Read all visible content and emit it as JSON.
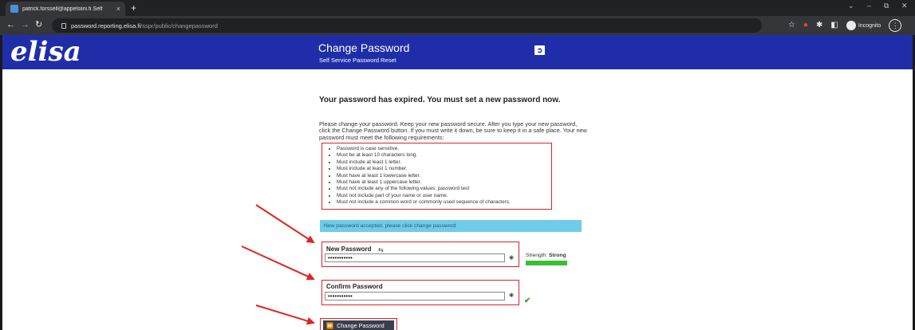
{
  "browser": {
    "tab_title": "patrick.forssell@appelsiini.fi Self",
    "tab_close": "×",
    "new_tab": "+",
    "url_host": "password.reporting.elisa.fi",
    "url_path": "/sspr/public/changepassword",
    "incognito_label": "Incognito",
    "icons": [
      "back-icon",
      "forward-icon",
      "reload-icon",
      "lock-icon",
      "star-icon",
      "extension-icon",
      "puzzle-icon",
      "sidepanel-icon",
      "incognito-icon",
      "menu-icon"
    ]
  },
  "header": {
    "logo": "elisa",
    "title": "Change Password",
    "subtitle": "Self Service Password Reset",
    "brand_color": "#1f2ea8"
  },
  "main": {
    "expired_message": "Your password has expired. You must set a new password now.",
    "intro_lines": [
      "Please change your password. Keep your new password secure. After you type your new password,",
      "click the Change Password button. If you must write it down, be sure to keep it in a safe place. Your new",
      "password must meet the following requirements:"
    ],
    "requirements": [
      "Password is case sensitive.",
      "Must be at least 10 characters long.",
      "Must include at least 1 letter.",
      "Must include at least 1 number.",
      "Must have at least 1 lowercase letter.",
      "Must have at least 1 uppercase letter.",
      "Must not include any of the following values: password test",
      "Must not include part of your name or user name.",
      "Must not include a common word or commonly used sequence of characters."
    ],
    "status_message": "New password accepted, please click change password",
    "new_password_label": "New Password",
    "new_password_value": "•••••••••••",
    "confirm_password_label": "Confirm Password",
    "confirm_password_value": "•••••••••••",
    "strength_label": "Strength:",
    "strength_value": "Strong",
    "strength_fraction": 1.0,
    "submit_label": "Change Password",
    "highlight_color": "#d9232d"
  }
}
